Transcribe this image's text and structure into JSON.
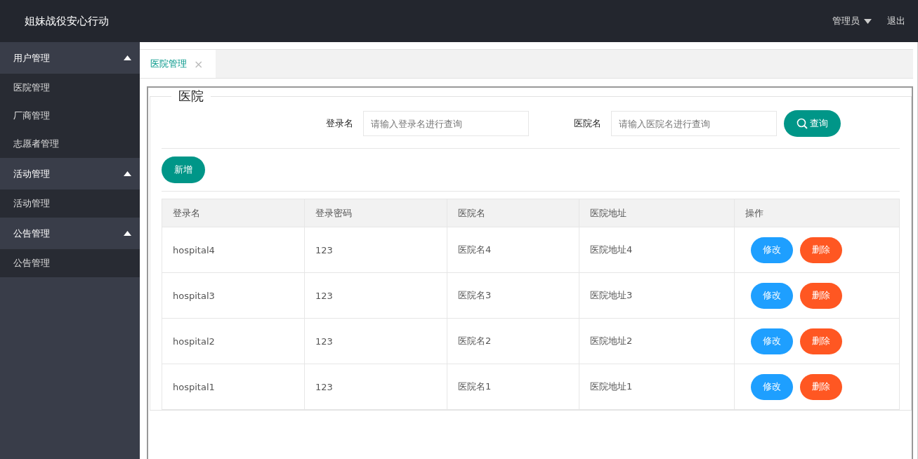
{
  "header": {
    "title": "姐妹战役安心行动",
    "user": "管理员",
    "logout": "退出"
  },
  "sidebar": {
    "groups": [
      {
        "label": "用户管理",
        "expanded": true,
        "children": [
          {
            "label": "医院管理"
          },
          {
            "label": "厂商管理"
          },
          {
            "label": "志愿者管理"
          }
        ]
      },
      {
        "label": "活动管理",
        "expanded": true,
        "children": [
          {
            "label": "活动管理"
          }
        ]
      },
      {
        "label": "公告管理",
        "expanded": true,
        "children": [
          {
            "label": "公告管理"
          }
        ]
      }
    ]
  },
  "tabs": [
    {
      "label": "医院管理",
      "selected": true,
      "close": "×"
    }
  ],
  "panel": {
    "legend": "医院",
    "search": [
      {
        "label": "登录名",
        "placeholder": "请输入登录名进行查询"
      },
      {
        "label": "医院名",
        "placeholder": "请输入医院名进行查询"
      }
    ],
    "search_button": "查询",
    "add_button": "新增",
    "table": {
      "columns": [
        "登录名",
        "登录密码",
        "医院名",
        "医院地址",
        "操作"
      ],
      "rows": [
        {
          "cells": [
            "hospital4",
            "123",
            "医院名4",
            "医院地址4"
          ],
          "actions": [
            "修改",
            "删除"
          ]
        },
        {
          "cells": [
            "hospital3",
            "123",
            "医院名3",
            "医院地址3"
          ],
          "actions": [
            "修改",
            "删除"
          ]
        },
        {
          "cells": [
            "hospital2",
            "123",
            "医院名2",
            "医院地址2"
          ],
          "actions": [
            "修改",
            "删除"
          ]
        },
        {
          "cells": [
            "hospital1",
            "123",
            "医院名1",
            "医院地址1"
          ],
          "actions": [
            "修改",
            "删除"
          ]
        }
      ]
    }
  }
}
